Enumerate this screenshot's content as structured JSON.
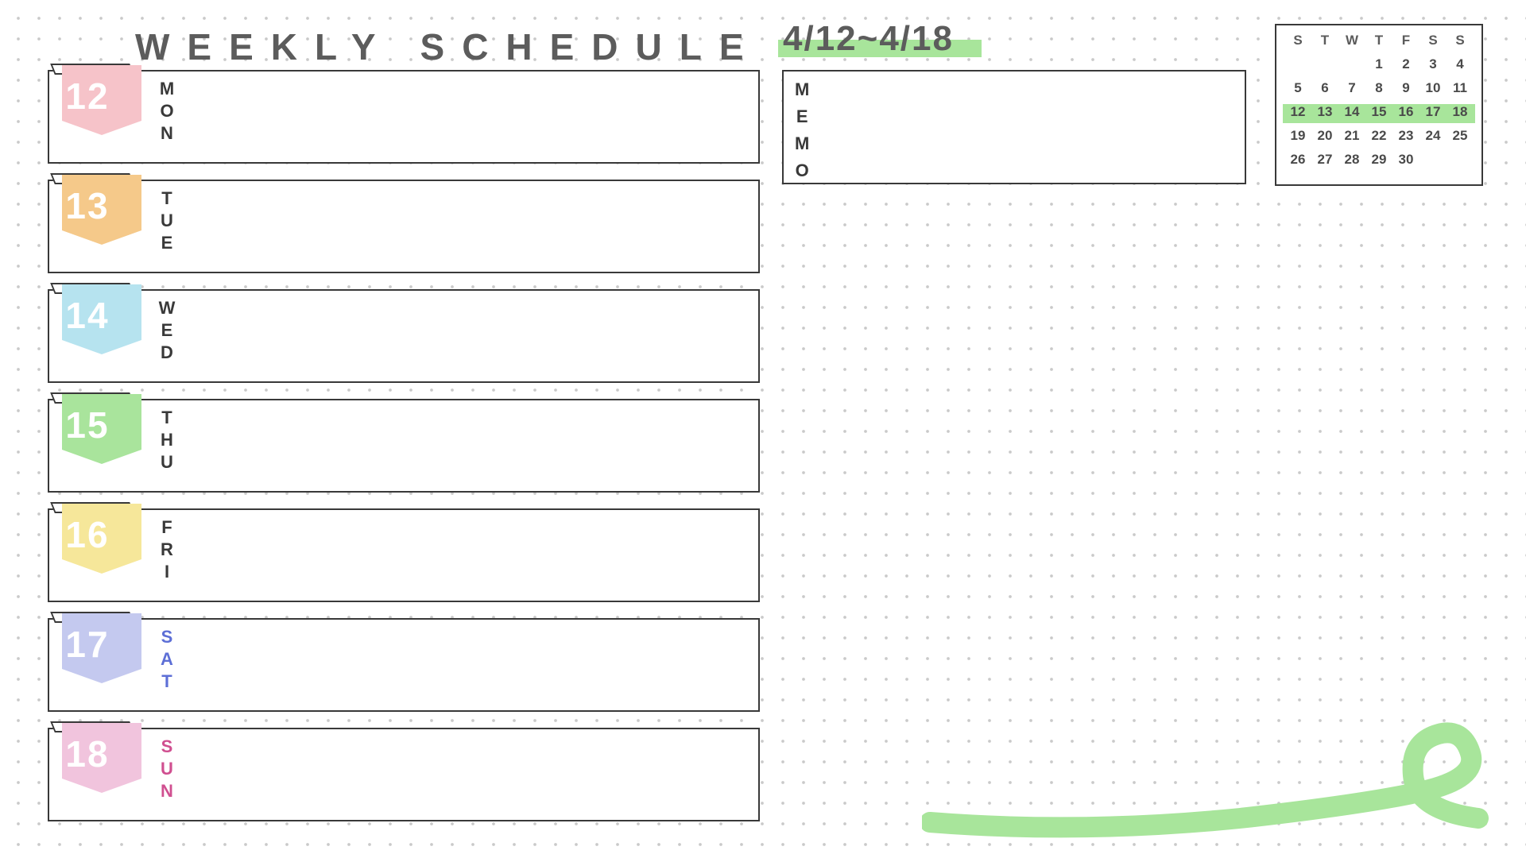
{
  "header": {
    "title": "WEEKLY SCHEDULE",
    "date_range": "4/12~4/18"
  },
  "colors": {
    "accent_highlight": "#a8e59b",
    "text": "#5c5c5c",
    "sat": "#5d6fd6",
    "sun": "#d04f90"
  },
  "days": [
    {
      "num": "12",
      "letters": [
        "M",
        "O",
        "N"
      ],
      "flag_color": "#f6c3c9",
      "label_class": ""
    },
    {
      "num": "13",
      "letters": [
        "T",
        "U",
        "E"
      ],
      "flag_color": "#f5c98a",
      "label_class": ""
    },
    {
      "num": "14",
      "letters": [
        "W",
        "E",
        "D"
      ],
      "flag_color": "#b6e3ef",
      "label_class": ""
    },
    {
      "num": "15",
      "letters": [
        "T",
        "H",
        "U"
      ],
      "flag_color": "#a9e49c",
      "label_class": ""
    },
    {
      "num": "16",
      "letters": [
        "F",
        "R",
        "I"
      ],
      "flag_color": "#f6e79a",
      "label_class": ""
    },
    {
      "num": "17",
      "letters": [
        "S",
        "A",
        "T"
      ],
      "flag_color": "#c4c9ef",
      "label_class": "sat"
    },
    {
      "num": "18",
      "letters": [
        "S",
        "U",
        "N"
      ],
      "flag_color": "#f1c4dd",
      "label_class": "sun"
    }
  ],
  "memo": {
    "letters": [
      "M",
      "E",
      "M",
      "O"
    ]
  },
  "calendar": {
    "headers": [
      "S",
      "T",
      "W",
      "T",
      "F",
      "S",
      "S"
    ],
    "rows": [
      [
        "",
        "",
        "",
        "1",
        "2",
        "3",
        "4"
      ],
      [
        "5",
        "6",
        "7",
        "8",
        "9",
        "10",
        "11"
      ],
      [
        "12",
        "13",
        "14",
        "15",
        "16",
        "17",
        "18"
      ],
      [
        "19",
        "20",
        "21",
        "22",
        "23",
        "24",
        "25"
      ],
      [
        "26",
        "27",
        "28",
        "29",
        "30",
        "",
        ""
      ]
    ],
    "highlight_row_index": 2
  }
}
